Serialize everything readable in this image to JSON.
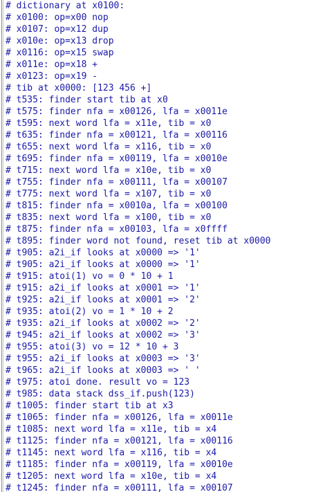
{
  "window": {
    "title": ""
  },
  "log_lines": [
    "# dictionary at x0100:",
    "# x0100: op=x00 nop",
    "# x0107: op=x12 dup",
    "# x010e: op=x13 drop",
    "# x0116: op=x15 swap",
    "# x011e: op=x18 +",
    "# x0123: op=x19 -",
    "# tib at x0000: [123 456 +]",
    "# t535: finder start tib at x0",
    "# t575: finder nfa = x00126, lfa = x0011e",
    "# t595: next word lfa = x11e, tib = x0",
    "# t635: finder nfa = x00121, lfa = x00116",
    "# t655: next word lfa = x116, tib = x0",
    "# t695: finder nfa = x00119, lfa = x0010e",
    "# t715: next word lfa = x10e, tib = x0",
    "# t755: finder nfa = x00111, lfa = x00107",
    "# t775: next word lfa = x107, tib = x0",
    "# t815: finder nfa = x0010a, lfa = x00100",
    "# t835: next word lfa = x100, tib = x0",
    "# t875: finder nfa = x00103, lfa = x0ffff",
    "# t895: finder word not found, reset tib at x0000",
    "# t905: a2i_if looks at x0000 => '1'",
    "# t905: a2i_if looks at x0000 => '1'",
    "# t915: atoi(1) vo = 0 * 10 + 1",
    "# t915: a2i_if looks at x0001 => '1'",
    "# t925: a2i_if looks at x0001 => '2'",
    "# t935: atoi(2) vo = 1 * 10 + 2",
    "# t935: a2i_if looks at x0002 => '2'",
    "# t945: a2i_if looks at x0002 => '3'",
    "# t955: atoi(3) vo = 12 * 10 + 3",
    "# t955: a2i_if looks at x0003 => '3'",
    "# t965: a2i_if looks at x0003 => ' '",
    "# t975: atoi done. result vo = 123",
    "# t985: data stack dss_if.push(123)",
    "# t1005: finder start tib at x3",
    "# t1065: finder nfa = x00126, lfa = x0011e",
    "# t1085: next word lfa = x11e, tib = x4",
    "# t1125: finder nfa = x00121, lfa = x00116",
    "# t1145: next word lfa = x116, tib = x4",
    "# t1185: finder nfa = x00119, lfa = x0010e",
    "# t1205: next word lfa = x10e, tib = x4",
    "# t1245: finder nfa = x00111, lfa = x00107"
  ],
  "colors": {
    "text": "#1a1aa8",
    "background": "#ffffff"
  }
}
